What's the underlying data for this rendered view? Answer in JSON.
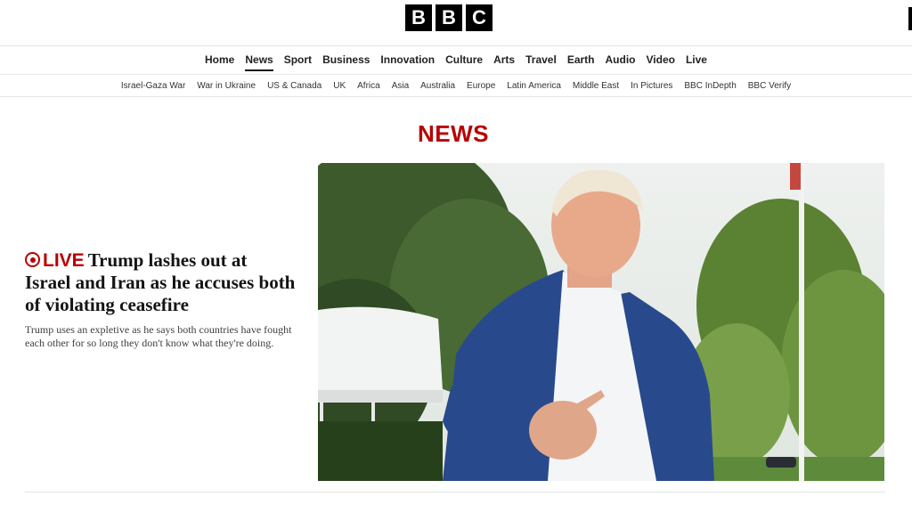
{
  "brand": {
    "letters": [
      "B",
      "B",
      "C"
    ]
  },
  "nav": {
    "items": [
      {
        "label": "Home"
      },
      {
        "label": "News",
        "active": true
      },
      {
        "label": "Sport"
      },
      {
        "label": "Business"
      },
      {
        "label": "Innovation"
      },
      {
        "label": "Culture"
      },
      {
        "label": "Arts"
      },
      {
        "label": "Travel"
      },
      {
        "label": "Earth"
      },
      {
        "label": "Audio"
      },
      {
        "label": "Video"
      },
      {
        "label": "Live"
      }
    ]
  },
  "subnav": {
    "items": [
      {
        "label": "Israel-Gaza War"
      },
      {
        "label": "War in Ukraine"
      },
      {
        "label": "US & Canada"
      },
      {
        "label": "UK"
      },
      {
        "label": "Africa"
      },
      {
        "label": "Asia"
      },
      {
        "label": "Australia"
      },
      {
        "label": "Europe"
      },
      {
        "label": "Latin America"
      },
      {
        "label": "Middle East"
      },
      {
        "label": "In Pictures"
      },
      {
        "label": "BBC InDepth"
      },
      {
        "label": "BBC Verify"
      }
    ]
  },
  "section_title": "NEWS",
  "lead_story": {
    "live_label": "LIVE",
    "headline": "Trump lashes out at Israel and Iran as he accuses both of violating ceasefire",
    "summary": "Trump uses an expletive as he says both countries have fought each other for so long they don't know what they're doing.",
    "image_icon": "news-photo"
  },
  "colors": {
    "brand_red": "#b80000",
    "text": "#141414",
    "divider": "#e4e4e4"
  }
}
